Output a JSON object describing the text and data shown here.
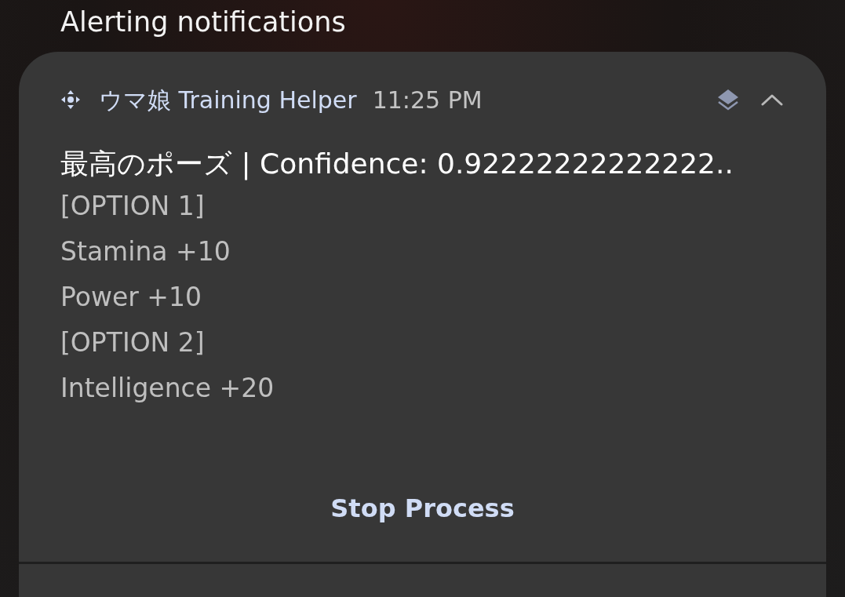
{
  "section_title": "Alerting notifications",
  "notification": {
    "app_name": "ウマ娘 Training Helper",
    "time": "11:25 PM",
    "expanded": true,
    "title": "最高のポーズ | Confidence: 0.92222222222222..",
    "lines": [
      "[OPTION 1]",
      "Stamina +10",
      "Power +10",
      "[OPTION 2]",
      "Intelligence +20"
    ],
    "actions": [
      "Stop Process"
    ]
  }
}
